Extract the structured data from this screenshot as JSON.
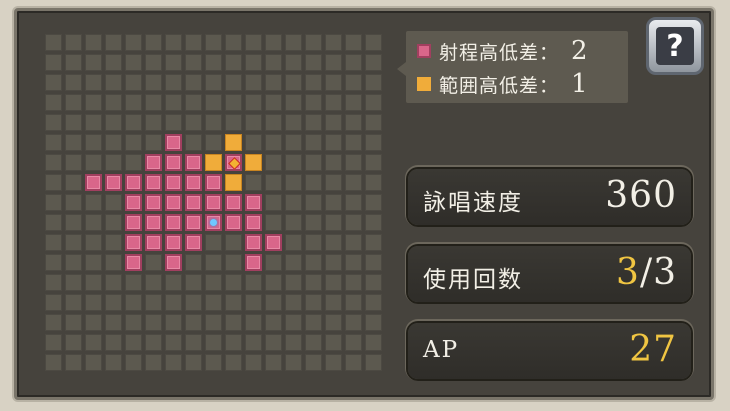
{
  "legend": {
    "range_height_label": "射程高低差：",
    "range_height_value": "2",
    "area_height_label": "範囲高低差：",
    "area_height_value": "1",
    "range_color": "#d9668a",
    "area_color": "#f0ac3a"
  },
  "help": {
    "icon": "help-book-icon",
    "glyph": "?"
  },
  "stats": {
    "cast_speed": {
      "label": "詠唱速度",
      "value": "360"
    },
    "uses": {
      "label": "使用回数",
      "current": "3",
      "separator": "/",
      "max": "3"
    },
    "ap": {
      "label": "AP",
      "value": "27"
    }
  },
  "grid": {
    "cols": 17,
    "rows": 17,
    "range_cells": [
      [
        7,
        2
      ],
      [
        7,
        3
      ],
      [
        7,
        4
      ],
      [
        8,
        4
      ],
      [
        9,
        4
      ],
      [
        10,
        4
      ],
      [
        11,
        4
      ],
      [
        6,
        5
      ],
      [
        7,
        5
      ],
      [
        8,
        5
      ],
      [
        9,
        5
      ],
      [
        10,
        5
      ],
      [
        5,
        6
      ],
      [
        6,
        6
      ],
      [
        7,
        6
      ],
      [
        8,
        6
      ],
      [
        9,
        6
      ],
      [
        10,
        6
      ],
      [
        11,
        6
      ],
      [
        6,
        7
      ],
      [
        7,
        7
      ],
      [
        8,
        7
      ],
      [
        9,
        7
      ],
      [
        10,
        7
      ],
      [
        7,
        8
      ],
      [
        8,
        8
      ],
      [
        9,
        8
      ],
      [
        8,
        9
      ],
      [
        9,
        9
      ],
      [
        8,
        10
      ],
      [
        9,
        10
      ],
      [
        10,
        10
      ],
      [
        11,
        10
      ],
      [
        10,
        11
      ]
    ],
    "height_cells": [
      [
        5,
        9
      ],
      [
        6,
        8
      ],
      [
        6,
        9
      ],
      [
        6,
        10
      ],
      [
        7,
        9
      ]
    ],
    "target_cell": [
      6,
      9
    ],
    "caster_cell": [
      9,
      8
    ]
  }
}
